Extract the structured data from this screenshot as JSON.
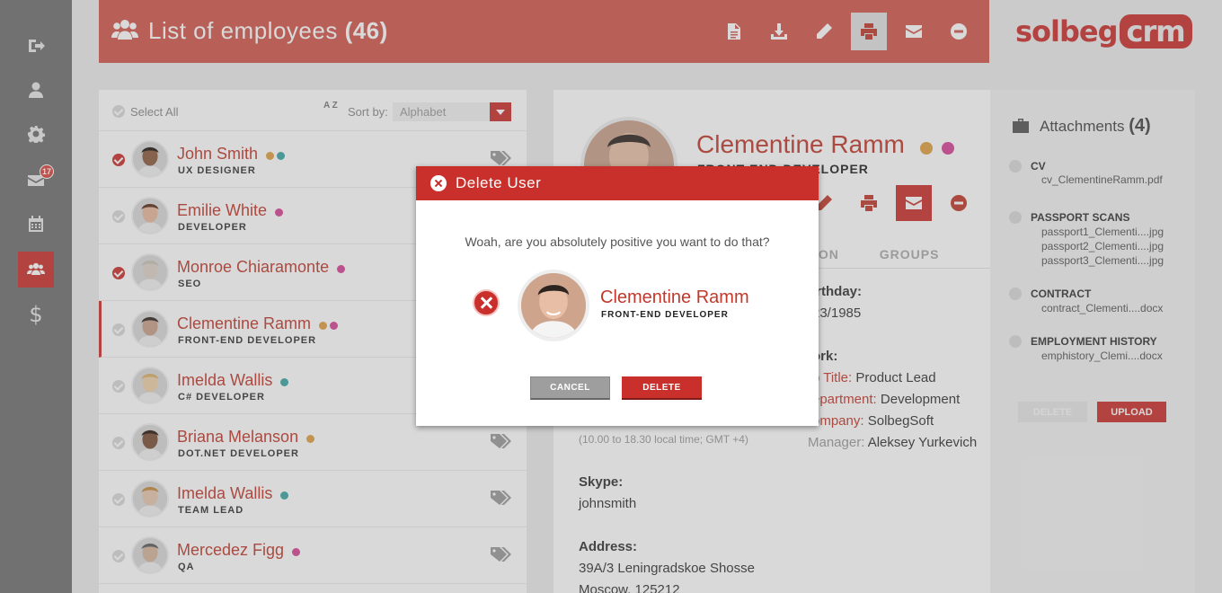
{
  "rail": {
    "items": [
      {
        "icon": "sign-out-icon"
      },
      {
        "icon": "user-icon"
      },
      {
        "icon": "gear-icon"
      },
      {
        "icon": "mail-icon",
        "badge": "17"
      },
      {
        "icon": "calendar-icon"
      },
      {
        "icon": "users-icon",
        "active": true
      },
      {
        "icon": "dollar-icon",
        "glyph": "$"
      }
    ]
  },
  "header": {
    "title": "List of employees",
    "count": "(46)",
    "actions": [
      "document-icon",
      "download-icon",
      "pencil-icon",
      "print-icon",
      "mail-icon",
      "minus-circle-icon"
    ],
    "active_action": "print-icon"
  },
  "logo": {
    "main": "solbeg",
    "badge": "crm"
  },
  "list": {
    "select_all": "Select All",
    "sort_label": "Sort by:",
    "sort_value": "Alphabet",
    "sort_icon_text": "A Z",
    "employees": [
      {
        "name": "John Smith",
        "role": "UX  DESIGNER",
        "checked": true,
        "dots": [
          "#e0a040",
          "#3ca6a6"
        ]
      },
      {
        "name": "Emilie White",
        "role": "DEVELOPER",
        "checked": false,
        "dots": [
          "#d64596"
        ]
      },
      {
        "name": "Monroe Chiaramonte",
        "role": "SEO",
        "checked": true,
        "dots": [
          "#d64596"
        ]
      },
      {
        "name": "Clementine Ramm",
        "role": "FRONT-END DEVELOPER",
        "checked": false,
        "selected": true,
        "dots": [
          "#e0a040",
          "#d64596"
        ]
      },
      {
        "name": "Imelda Wallis",
        "role": "C# DEVELOPER",
        "checked": false,
        "dots": [
          "#3ca6a6"
        ]
      },
      {
        "name": "Briana Melanson",
        "role": "DOT.NET DEVELOPER",
        "checked": false,
        "dots": [
          "#e0a040"
        ]
      },
      {
        "name": "Imelda Wallis",
        "role": "TEAM LEAD",
        "checked": false,
        "dots": [
          "#3ca6a6"
        ]
      },
      {
        "name": "Mercedez Figg",
        "role": "QA",
        "checked": false,
        "dots": [
          "#d64596"
        ]
      }
    ]
  },
  "profile": {
    "name": "Clementine Ramm",
    "role": "FRONT-END DEVELOPER",
    "dots": [
      "#e0a040",
      "#d64596"
    ],
    "tabs": [
      "ION",
      "GROUPS"
    ],
    "birthday_label": "irthday:",
    "birthday_value": "23/1985",
    "work_label": "ork:",
    "job_title_key": "b Title:",
    "job_title_value": "Product Lead",
    "department_key": "epartment:",
    "department_value": "Development",
    "company_key": "ompany:",
    "company_value": "SolbegSoft",
    "manager_key": "Manager:",
    "manager_value": "Aleksey Yurkevich",
    "local_time": "(10.00 to 18.30 local time; GMT +4)",
    "skype_label": "Skype:",
    "skype_value": "johnsmith",
    "address_label": "Address:",
    "address_line1": "39A/3 Leningradskoe Shosse",
    "address_line2": "Moscow, 125212"
  },
  "attachments": {
    "title": "Attachments",
    "count": "(4)",
    "groups": [
      {
        "label": "CV",
        "files": [
          "cv_ClementineRamm.pdf"
        ]
      },
      {
        "label": "PASSPORT SCANS",
        "files": [
          "passport1_Clementi....jpg",
          "passport2_Clementi....jpg",
          "passport3_Clementi....jpg"
        ]
      },
      {
        "label": "CONTRACT",
        "files": [
          "contract_Clementi....docx"
        ]
      },
      {
        "label": "EMPLOYMENT HISTORY",
        "files": [
          "emphistory_Clemi....docx"
        ]
      }
    ],
    "delete_label": "DELETE",
    "upload_label": "UPLOAD"
  },
  "modal": {
    "title": "Delete User",
    "question": "Woah, are you absolutely positive you want to do that?",
    "user_name": "Clementine Ramm",
    "user_role": "FRONT-END DEVELOPER",
    "cancel_label": "CANCEL",
    "delete_label": "DELETE"
  },
  "colors": {
    "accent": "#c9302c",
    "header_bg": "#d1564b",
    "rail_bg": "#6f6f6f"
  }
}
